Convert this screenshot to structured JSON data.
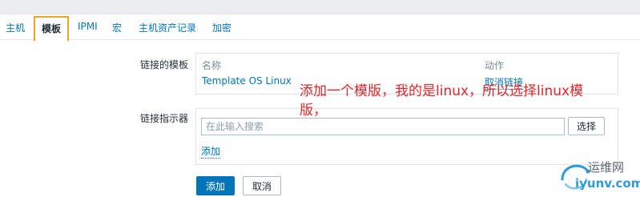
{
  "tabs": [
    {
      "label": "主机",
      "active": false
    },
    {
      "label": "模板",
      "active": true
    },
    {
      "label": "IPMI",
      "active": false
    },
    {
      "label": "宏",
      "active": false
    },
    {
      "label": "主机资产记录",
      "active": false
    },
    {
      "label": "加密",
      "active": false
    }
  ],
  "linked_templates": {
    "label": "链接的模板",
    "column_name": "名称",
    "column_action": "动作",
    "rows": [
      {
        "name": "Template OS Linux",
        "action": "取消链接"
      }
    ]
  },
  "link_indicator": {
    "label": "链接指示器",
    "search_placeholder": "在此输入搜索",
    "select_label": "选择",
    "add_link": "添加"
  },
  "buttons": {
    "add": "添加",
    "cancel": "取消"
  },
  "annotation": {
    "line1": "添加一个模版，我的是linux，所以选择linux模",
    "line2": "版，",
    "color": "#e8262a"
  },
  "watermark": {
    "line1": "运维网",
    "line2": "iyunv.com"
  },
  "colors": {
    "accent": "#0275b8",
    "active_tab_border": "#f0a52a"
  }
}
